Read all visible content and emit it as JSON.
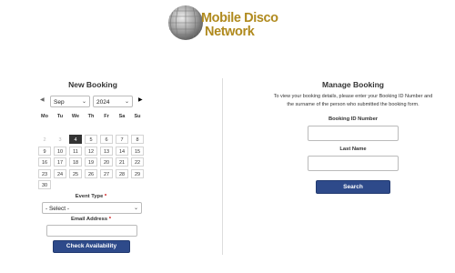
{
  "brand": {
    "line1": "Mobile Disco",
    "line2": "Network",
    "color": "#b08a1e"
  },
  "new_booking": {
    "title": "New Booking",
    "prev_icon": "prev-month-icon",
    "next_icon": "next-month-icon",
    "month": "Sep",
    "year": "2024",
    "weekdays": [
      "Mo",
      "Tu",
      "We",
      "Th",
      "Fr",
      "Sa",
      "Su"
    ],
    "weeks": [
      [
        "2",
        "3",
        "4",
        "5",
        "6",
        "7",
        "8"
      ],
      [
        "9",
        "10",
        "11",
        "12",
        "13",
        "14",
        "15"
      ],
      [
        "16",
        "17",
        "18",
        "19",
        "20",
        "21",
        "22"
      ],
      [
        "23",
        "24",
        "25",
        "26",
        "27",
        "28",
        "29"
      ],
      [
        "30"
      ]
    ],
    "today": "4",
    "event_type_label": "Event Type",
    "event_type_value": "- Select -",
    "email_label": "Email Address",
    "required_mark": "*",
    "check_button": "Check Availability",
    "accent": "#2e4a8a"
  },
  "manage_booking": {
    "title": "Manage Booking",
    "description": "To view your booking details, please enter your Booking ID Number and the surname of the person who submitted the booking form.",
    "booking_id_label": "Booking ID Number",
    "last_name_label": "Last Name",
    "search_button": "Search"
  }
}
